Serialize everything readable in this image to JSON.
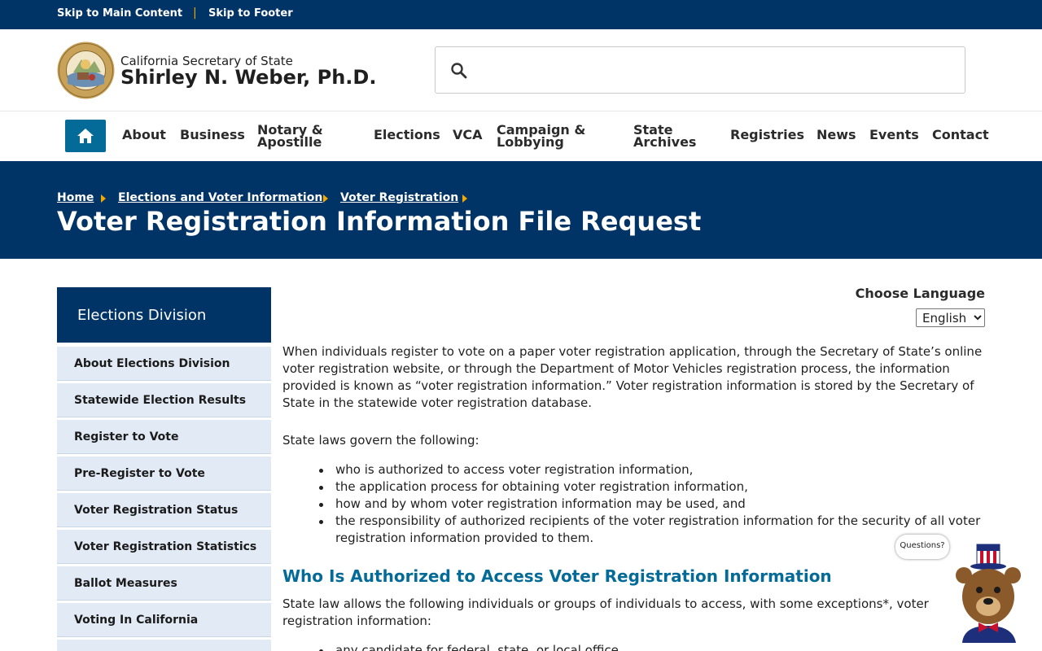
{
  "skip_links": {
    "main": "Skip to Main Content",
    "separator": "|",
    "footer": "Skip to Footer"
  },
  "header": {
    "org": "California Secretary of State",
    "name": "Shirley N. Weber, Ph.D.",
    "search_placeholder": ""
  },
  "nav": {
    "home_icon": "home-icon",
    "items": [
      "About",
      "Business",
      "Notary & Apostille",
      "Elections",
      "VCA",
      "Campaign & Lobbying",
      "State Archives",
      "Registries",
      "News",
      "Events",
      "Contact"
    ]
  },
  "breadcrumb": [
    "Home",
    "Elections and Voter Information",
    "Voter Registration"
  ],
  "page_title": "Voter Registration Information File Request",
  "sidebar": {
    "heading": "Elections Division",
    "items": [
      "About Elections Division",
      "Statewide Election Results",
      "Register to Vote",
      "Pre-Register to Vote",
      "Voter Registration Status",
      "Voter Registration Statistics",
      "Ballot Measures",
      "Voting In California"
    ]
  },
  "language": {
    "label": "Choose Language",
    "selected": "English"
  },
  "content": {
    "intro": "When individuals register to vote on a paper voter registration application, through the Secretary of State’s online voter registration website, or through the Department of Motor Vehicles registration process, the information provided is known as “voter registration information.” Voter registration information is stored by the Secretary of State in the statewide voter registration database.",
    "laws_intro": "State laws govern the following:",
    "laws": [
      "who is authorized to access voter registration information,",
      "the application process for obtaining voter registration information,",
      "how and by whom voter registration information may be used, and",
      "the responsibility of authorized recipients of the voter registration information for the security of all voter registration information provided to them."
    ],
    "heading": "Who Is Authorized to Access Voter Registration Information",
    "access_intro": "State law allows the following individuals or groups of individuals to access, with some exceptions*, voter registration information:",
    "access_list": [
      "any candidate for federal, state, or local office,"
    ]
  },
  "chat": {
    "bubble": "Questions?",
    "icon": "bear-mascot-icon"
  },
  "colors": {
    "navy": "#003366",
    "accent_blue": "#046b99",
    "gold": "#f2a900",
    "sidebar_bg": "#e1eaf5"
  }
}
